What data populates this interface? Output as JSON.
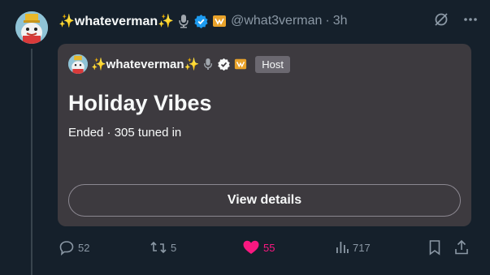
{
  "tweet": {
    "display_name": "✨whateverman✨",
    "handle": "@what3verman",
    "separator": "·",
    "time": "3h"
  },
  "card": {
    "display_name": "✨whateverman✨",
    "host_label": "Host",
    "title": "Holiday Vibes",
    "subtitle": "Ended · 305 tuned in",
    "button_label": "View details"
  },
  "actions": {
    "replies": "52",
    "reposts": "5",
    "likes": "55",
    "views": "717"
  },
  "colors": {
    "background": "#15202b",
    "card": "#3d3a3f",
    "muted": "#8b98a5",
    "like": "#f91880",
    "verified": "#1d9bf0"
  },
  "icons": [
    "avatar",
    "microphone-icon",
    "verified-badge-icon",
    "affiliate-badge-icon",
    "grok-icon",
    "more-icon",
    "reply-icon",
    "repost-icon",
    "heart-icon",
    "views-icon",
    "bookmark-icon",
    "share-icon"
  ]
}
